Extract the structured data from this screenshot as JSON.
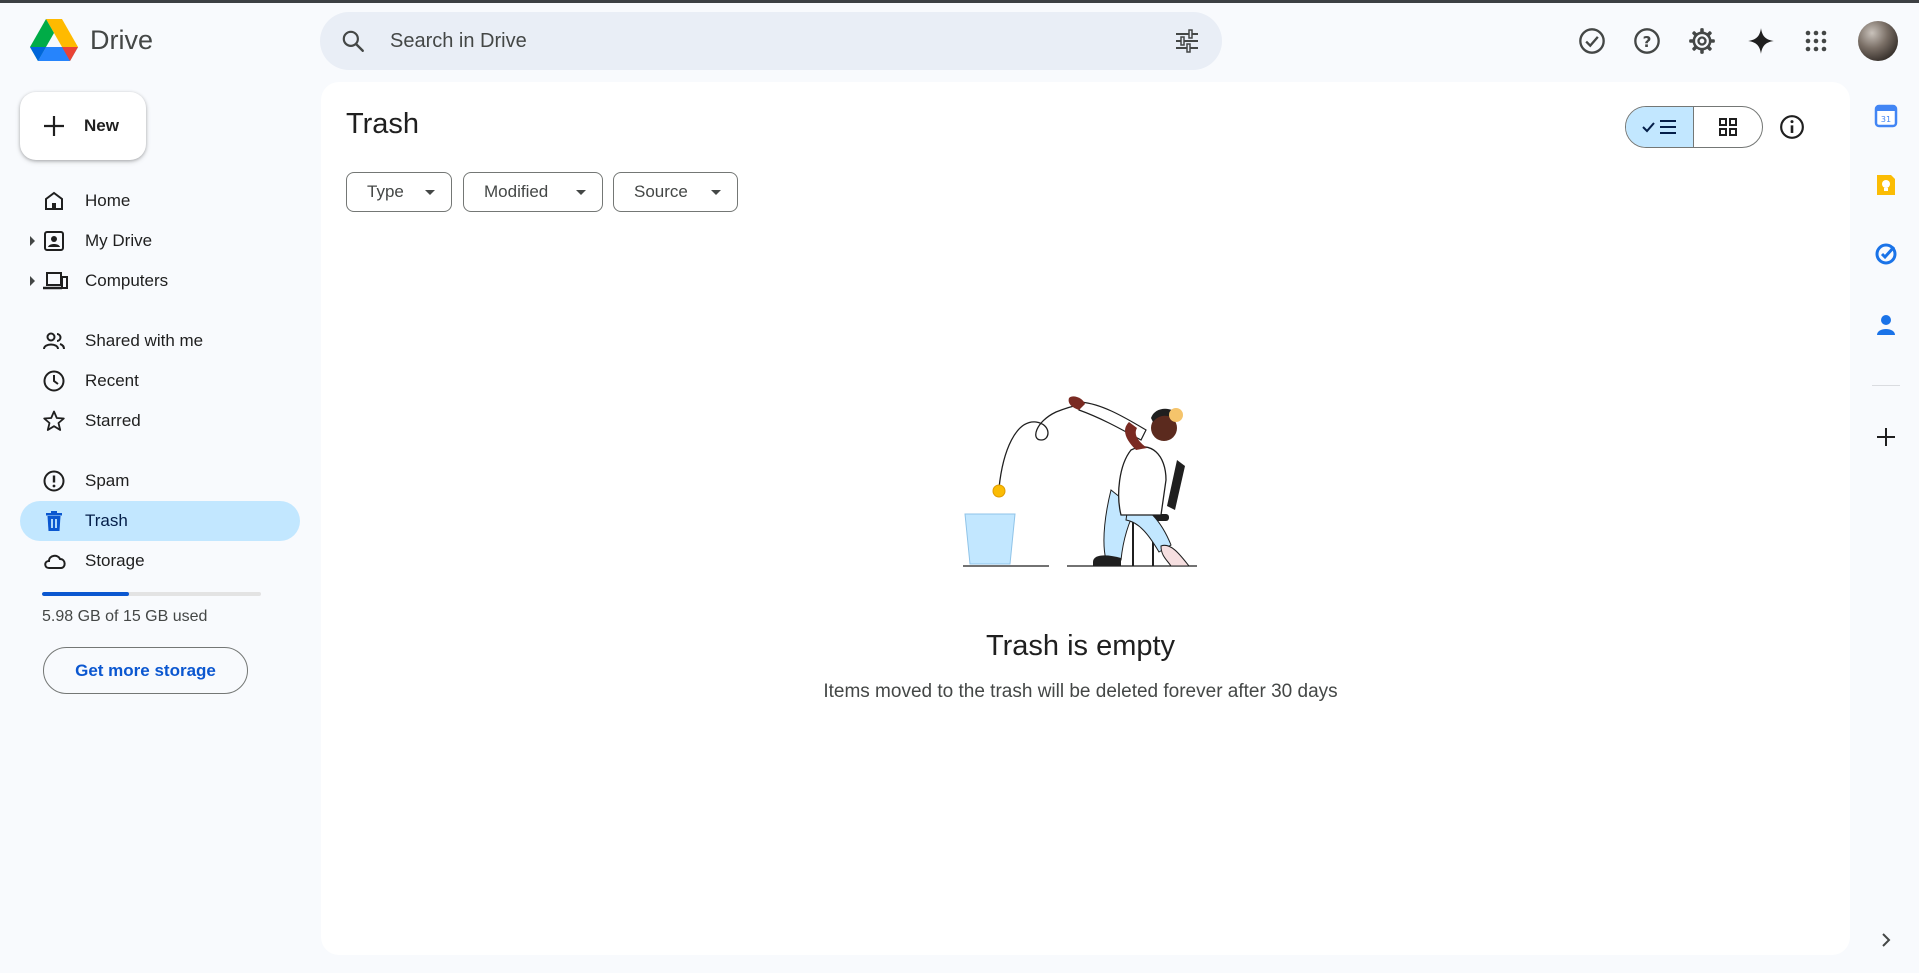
{
  "app": {
    "name": "Drive"
  },
  "search": {
    "placeholder": "Search in Drive",
    "value": ""
  },
  "header_icons": [
    "offline-ready-icon",
    "help-icon",
    "settings-icon",
    "gemini-icon",
    "apps-grid-icon"
  ],
  "sidebar": {
    "new_label": "New",
    "items": [
      {
        "label": "Home",
        "icon": "home-icon"
      },
      {
        "label": "My Drive",
        "icon": "my-drive-icon"
      },
      {
        "label": "Computers",
        "icon": "computers-icon"
      },
      {
        "label": "Shared with me",
        "icon": "shared-icon"
      },
      {
        "label": "Recent",
        "icon": "clock-icon"
      },
      {
        "label": "Starred",
        "icon": "star-icon"
      },
      {
        "label": "Spam",
        "icon": "spam-icon"
      },
      {
        "label": "Trash",
        "icon": "trash-icon",
        "active": true
      },
      {
        "label": "Storage",
        "icon": "cloud-icon"
      }
    ],
    "storage": {
      "used_text": "5.98 GB of 15 GB used",
      "used_fraction": 0.399,
      "cta": "Get more storage"
    }
  },
  "main": {
    "title": "Trash",
    "filters": [
      "Type",
      "Modified",
      "Source"
    ],
    "empty_title": "Trash is empty",
    "empty_subtitle": "Items moved to the trash will be deleted forever after 30 days"
  },
  "side_panel": [
    "calendar-app-icon",
    "keep-app-icon",
    "tasks-app-icon",
    "contacts-app-icon",
    "add-addon-icon"
  ],
  "colors": {
    "accent": "#0b57d0",
    "active_bg": "#c2e7ff",
    "page_bg": "#f8fafd"
  }
}
